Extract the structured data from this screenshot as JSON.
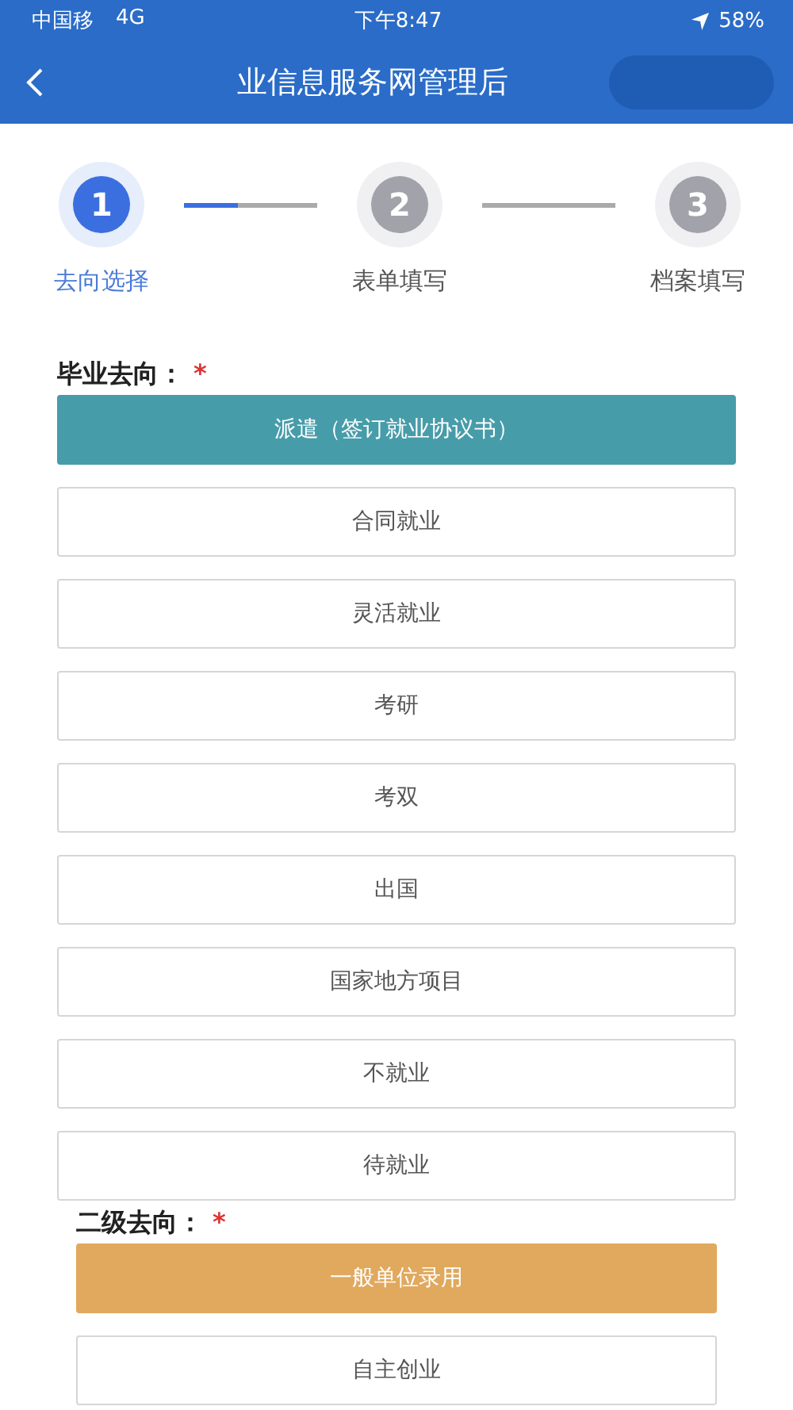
{
  "status_bar": {
    "carrier": "中国移",
    "network": "4G",
    "time": "下午8:47",
    "battery": "58%"
  },
  "nav": {
    "title": "业信息服务网管理后"
  },
  "steps": [
    {
      "number": "1",
      "label": "去向选择",
      "selected": true,
      "level": 0.4
    },
    {
      "number": "2",
      "label": "表单填写",
      "selected": false,
      "level": 0
    },
    {
      "number": "3",
      "label": "档案填写",
      "selected": false
    }
  ],
  "groups": [
    {
      "kind": "primary",
      "label": "毕业去向：",
      "required_mark": "*",
      "options": [
        {
          "label": "派遣（签订就业协议书）",
          "selected": true
        },
        {
          "label": "合同就业",
          "selected": false
        },
        {
          "label": "灵活就业",
          "selected": false
        },
        {
          "label": "考研",
          "selected": false
        },
        {
          "label": "考双",
          "selected": false
        },
        {
          "label": "出国",
          "selected": false
        },
        {
          "label": "国家地方项目",
          "selected": false
        },
        {
          "label": "不就业",
          "selected": false
        },
        {
          "label": "待就业",
          "selected": false
        }
      ]
    },
    {
      "kind": "secondary",
      "label": "二级去向：",
      "required_mark": "*",
      "options": [
        {
          "label": "一般单位录用",
          "selected": true
        },
        {
          "label": "自主创业",
          "selected": false
        }
      ]
    }
  ]
}
